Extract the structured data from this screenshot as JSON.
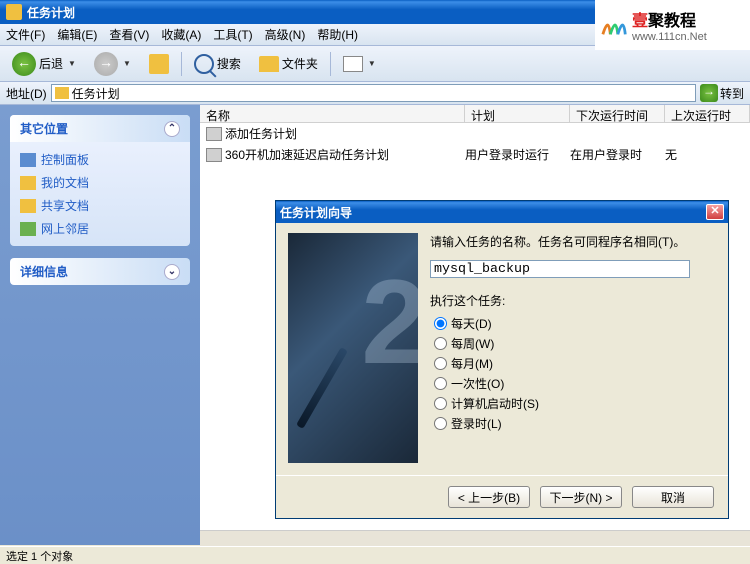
{
  "window": {
    "title": "任务计划"
  },
  "watermark": {
    "brand_prefix": "壹",
    "brand_rest": "聚教程",
    "url": "www.111cn.Net"
  },
  "menu": {
    "file": "文件(F)",
    "edit": "编辑(E)",
    "view": "查看(V)",
    "fav": "收藏(A)",
    "tools": "工具(T)",
    "adv": "高级(N)",
    "help": "帮助(H)"
  },
  "toolbar": {
    "back": "后退",
    "search": "搜索",
    "folders": "文件夹"
  },
  "addr": {
    "label": "地址(D)",
    "value": "任务计划",
    "go": "转到"
  },
  "sidebar": {
    "panel1": {
      "title": "其它位置",
      "items": [
        "控制面板",
        "我的文档",
        "共享文档",
        "网上邻居"
      ]
    },
    "panel2": {
      "title": "详细信息"
    }
  },
  "columns": {
    "name": "名称",
    "plan": "计划",
    "next": "下次运行时间",
    "last": "上次运行时"
  },
  "rows": [
    {
      "name": "添加任务计划",
      "plan": "",
      "next": "",
      "last": ""
    },
    {
      "name": "360开机加速延迟启动任务计划",
      "plan": "用户登录时运行",
      "next": "在用户登录时",
      "last": "无"
    }
  ],
  "dialog": {
    "title": "任务计划向导",
    "prompt": "请输入任务的名称。任务名可同程序名相同(T)。",
    "input_value": "mysql_backup",
    "run_label": "执行这个任务:",
    "options": [
      "每天(D)",
      "每周(W)",
      "每月(M)",
      "一次性(O)",
      "计算机启动时(S)",
      "登录时(L)"
    ],
    "selected": 0,
    "back_btn": "< 上一步(B)",
    "next_btn": "下一步(N) >",
    "cancel_btn": "取消"
  },
  "status": "选定 1 个对象"
}
